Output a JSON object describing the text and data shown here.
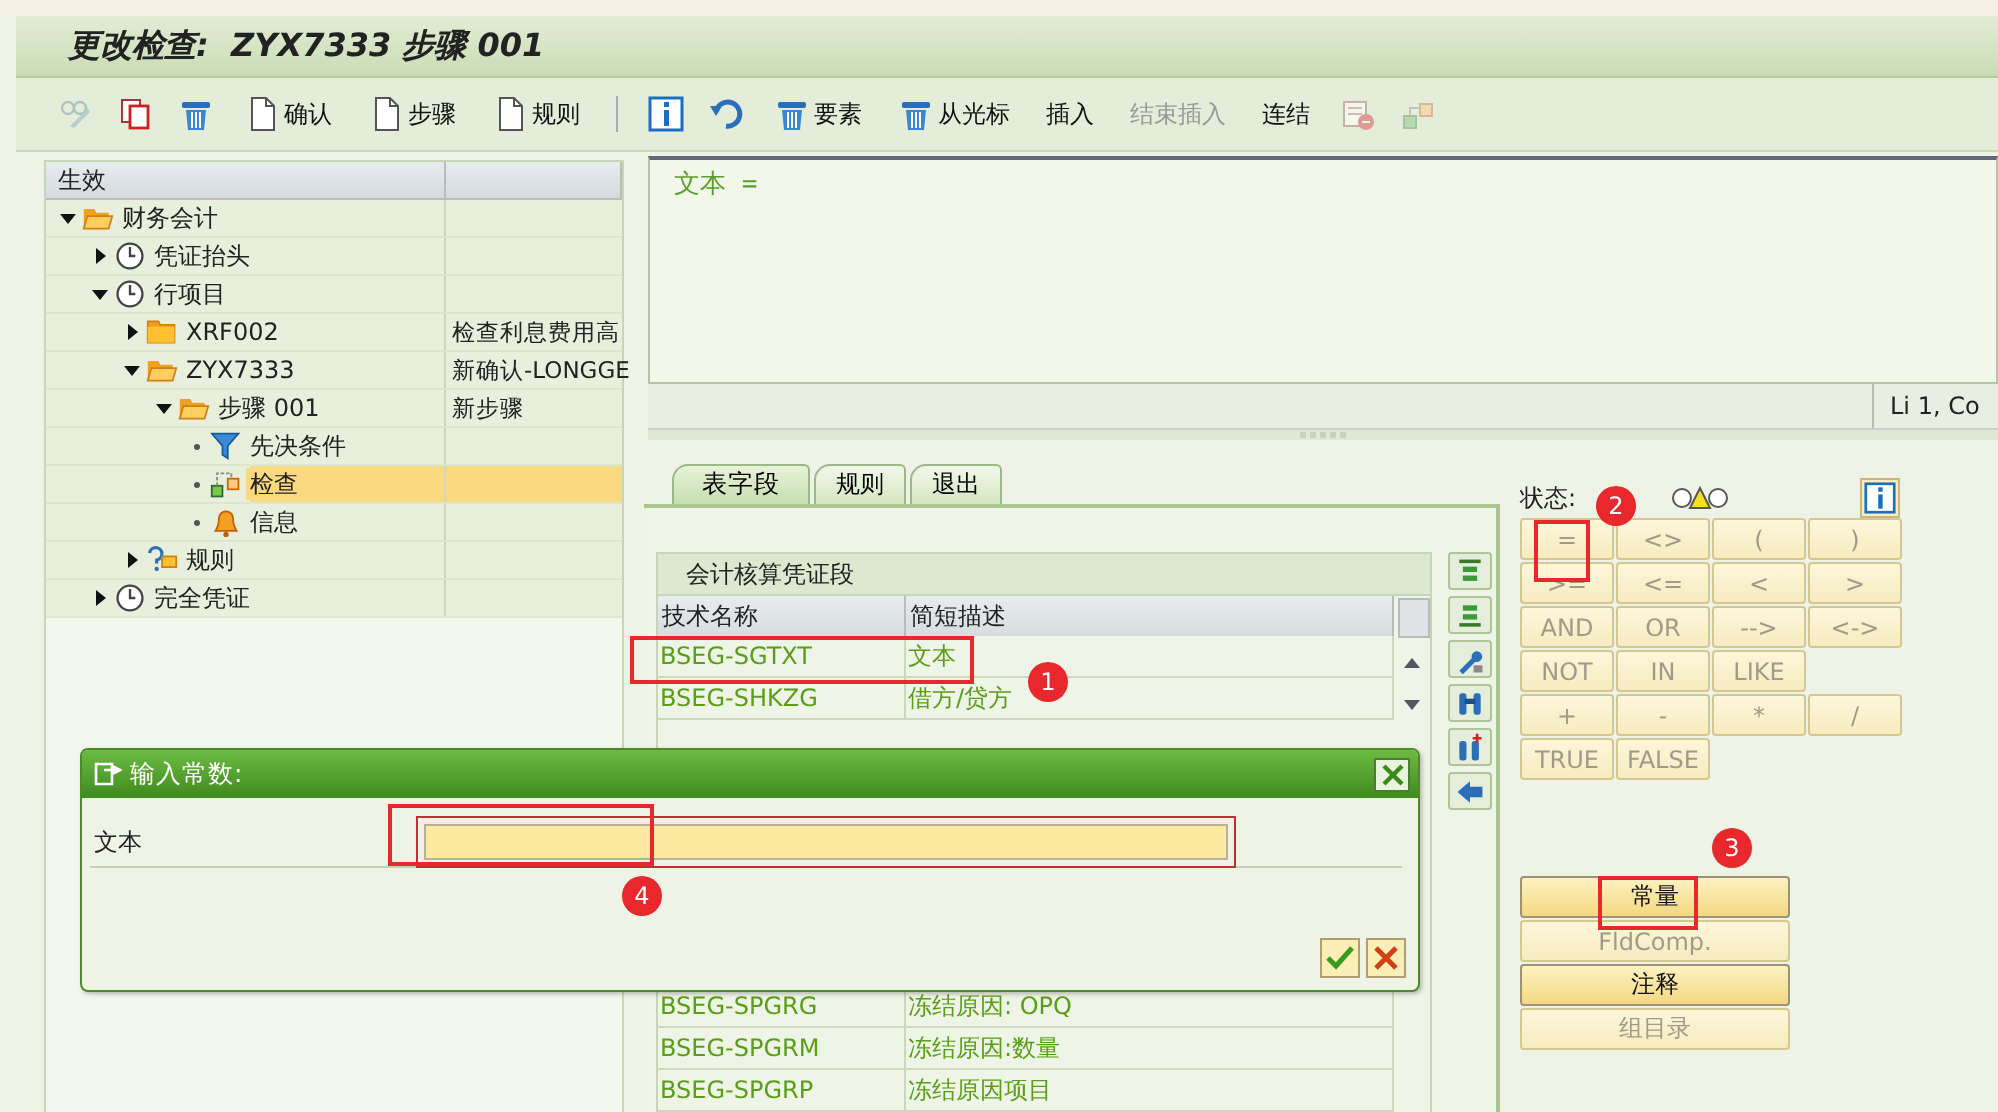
{
  "window": {
    "title": "更改检查:  ZYX7333 步骤 001"
  },
  "toolbar": [
    {
      "kind": "icon",
      "disabled": true
    },
    {
      "kind": "icon",
      "disabled": false
    },
    {
      "kind": "icon",
      "disabled": false
    },
    {
      "kind": "button",
      "label": "确认",
      "disabled": false
    },
    {
      "kind": "button",
      "label": "步骤",
      "disabled": false
    },
    {
      "kind": "button",
      "label": "规则",
      "disabled": false
    },
    {
      "kind": "separator"
    },
    {
      "kind": "icon",
      "disabled": false
    },
    {
      "kind": "icon",
      "disabled": false
    },
    {
      "kind": "button",
      "label": "要素",
      "disabled": false
    },
    {
      "kind": "button",
      "label": "从光标",
      "disabled": false
    },
    {
      "kind": "button",
      "label": "插入",
      "disabled": false
    },
    {
      "kind": "button",
      "label": "结束插入",
      "disabled": true
    },
    {
      "kind": "button",
      "label": "连结",
      "disabled": false
    },
    {
      "kind": "icon",
      "disabled": true
    },
    {
      "kind": "icon",
      "disabled": true
    }
  ],
  "tree": {
    "header": "生效",
    "items": [
      {
        "label": "财务会计",
        "kind": "folder",
        "expanded": true,
        "selected": false,
        "children": [
          {
            "label": "凭证抬头",
            "kind": "clock",
            "expanded": false,
            "selected": false
          },
          {
            "label": "行项目",
            "kind": "clock",
            "expanded": true,
            "selected": false,
            "children": [
              {
                "label": "XRF002",
                "kind": "folder",
                "expanded": false,
                "selected": false,
                "description": "检查利息费用高"
              },
              {
                "label": "ZYX7333",
                "kind": "folder",
                "expanded": true,
                "selected": false,
                "description": "新确认-LONGGE",
                "children": [
                  {
                    "label": "步骤 001",
                    "kind": "folder",
                    "expanded": true,
                    "selected": false,
                    "description": "新步骤",
                    "children": [
                      {
                        "label": "先决条件",
                        "kind": "filter",
                        "selected": false
                      },
                      {
                        "label": "检查",
                        "kind": "check",
                        "selected": true
                      },
                      {
                        "label": "信息",
                        "kind": "bell",
                        "selected": false
                      }
                    ]
                  }
                ]
              },
              {
                "label": "规则",
                "kind": "rule",
                "expanded": false,
                "selected": false
              }
            ]
          },
          {
            "label": "完全凭证",
            "kind": "clock",
            "expanded": false,
            "selected": false
          }
        ]
      }
    ]
  },
  "editor": {
    "text": "文本 =",
    "position": "Li 1, Co"
  },
  "tabs": [
    {
      "label": "表字段",
      "selected": true
    },
    {
      "label": "规则",
      "selected": false
    },
    {
      "label": "退出",
      "selected": false
    }
  ],
  "table": {
    "title": "会计核算凭证段",
    "columns": [
      "技术名称",
      "简短描述"
    ],
    "rows_top": [
      {
        "name": "BSEG-SGTXT",
        "description": "文本"
      },
      {
        "name": "BSEG-SHKZG",
        "description": "借方/贷方"
      }
    ],
    "rows_bottom": [
      {
        "name": "BSEG-SPGRG",
        "description": "冻结原因: OPQ"
      },
      {
        "name": "BSEG-SPGRM",
        "description": "冻结原因:数量"
      },
      {
        "name": "BSEG-SPGRP",
        "description": "冻结原因项目"
      }
    ]
  },
  "status_label": "状态:",
  "operators": [
    {
      "label": "=",
      "disabled": true
    },
    {
      "label": "<>",
      "disabled": true
    },
    {
      "label": "(",
      "disabled": true
    },
    {
      "label": ")",
      "disabled": true
    },
    {
      "label": ">=",
      "disabled": true
    },
    {
      "label": "<=",
      "disabled": true
    },
    {
      "label": "<",
      "disabled": true
    },
    {
      "label": ">",
      "disabled": true
    },
    {
      "label": "AND",
      "disabled": true
    },
    {
      "label": "OR",
      "disabled": true
    },
    {
      "label": "-->",
      "disabled": true
    },
    {
      "label": "<->",
      "disabled": true
    },
    {
      "label": "NOT",
      "disabled": true
    },
    {
      "label": "IN",
      "disabled": true
    },
    {
      "label": "LIKE",
      "disabled": true
    },
    {
      "kind": "blank"
    },
    {
      "label": "+",
      "disabled": true
    },
    {
      "label": "-",
      "disabled": true
    },
    {
      "label": "*",
      "disabled": true
    },
    {
      "label": "/",
      "disabled": true
    },
    {
      "label": "TRUE",
      "disabled": true
    },
    {
      "label": "FALSE",
      "disabled": true
    }
  ],
  "actions": [
    {
      "label": "常量",
      "disabled": false
    },
    {
      "label": "FldComp.",
      "disabled": true
    },
    {
      "label": "注释",
      "disabled": false
    },
    {
      "label": "组目录",
      "disabled": true
    }
  ],
  "dialog": {
    "title": "输入常数:",
    "field_label": "文本"
  },
  "annotations": [
    {
      "label": "1"
    },
    {
      "label": "2"
    },
    {
      "label": "3"
    },
    {
      "label": "4"
    }
  ]
}
